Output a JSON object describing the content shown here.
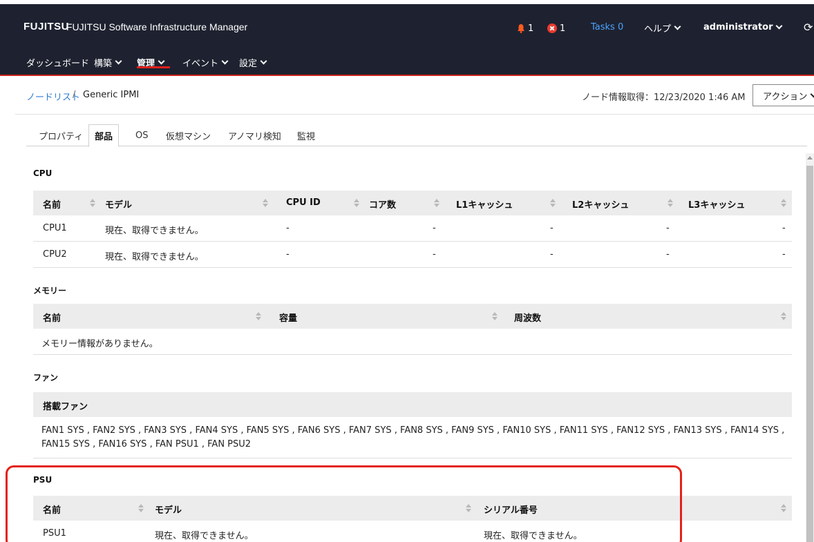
{
  "header": {
    "logo": "FUJITSU",
    "product": "FUJITSU Software Infrastructure Manager",
    "warn_count": "1",
    "error_count": "1",
    "tasks": "Tasks 0",
    "help": "ヘルプ",
    "user": "administrator",
    "colors": {
      "bg": "#1e2230",
      "accent_red": "#c8201a",
      "tasks": "#4aa3ff"
    }
  },
  "nav": {
    "items": [
      "ダッシュボード",
      "構築",
      "管理",
      "イベント",
      "設定"
    ],
    "active": "管理"
  },
  "breadcrumb": {
    "link": "ノードリスト",
    "separator": "/",
    "current": "Generic IPMI",
    "node_info": "ノード情報取得：12/23/2020 1:46 AM",
    "action": "アクション"
  },
  "tabs": [
    "プロパティ",
    "部品",
    "OS",
    "仮想マシン",
    "アノマリ検知",
    "監視"
  ],
  "active_tab": "部品",
  "cpu": {
    "title": "CPU",
    "headers": [
      "名前",
      "モデル",
      "CPU ID",
      "コア数",
      "L1キャッシュ",
      "L2キャッシュ",
      "L3キャッシュ"
    ],
    "rows": [
      [
        "CPU1",
        "現在、取得できません。",
        "-",
        "-",
        "-",
        "-",
        "-"
      ],
      [
        "CPU2",
        "現在、取得できません。",
        "-",
        "-",
        "-",
        "-",
        "-"
      ]
    ]
  },
  "memory": {
    "title": "メモリー",
    "headers": [
      "名前",
      "容量",
      "周波数"
    ],
    "empty": "メモリー情報がありません。"
  },
  "fan": {
    "title": "ファン",
    "header": "搭載ファン",
    "text": "FAN1 SYS , FAN2 SYS , FAN3 SYS , FAN4 SYS , FAN5 SYS , FAN6 SYS , FAN7 SYS , FAN8 SYS , FAN9 SYS , FAN10 SYS , FAN11 SYS , FAN12 SYS , FAN13 SYS , FAN14 SYS , FAN15 SYS , FAN16 SYS , FAN PSU1 , FAN PSU2"
  },
  "psu": {
    "title": "PSU",
    "headers": [
      "名前",
      "モデル",
      "シリアル番号"
    ],
    "rows": [
      [
        "PSU1",
        "現在、取得できません。",
        "現在、取得できません。"
      ]
    ]
  }
}
